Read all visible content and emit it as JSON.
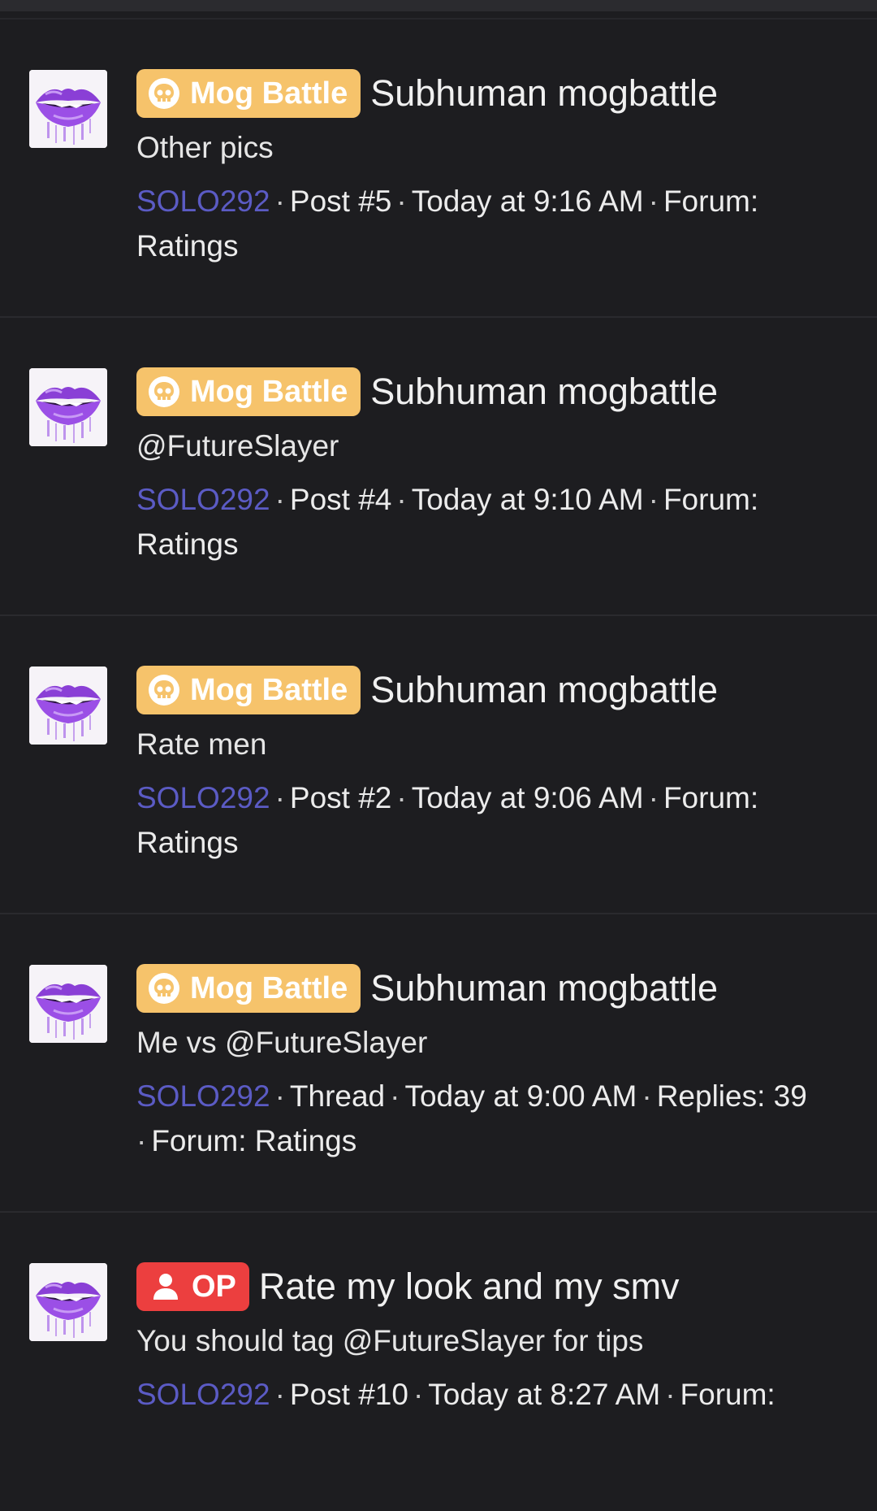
{
  "results": [
    {
      "badge": {
        "type": "mog",
        "label": "Mog Battle",
        "icon": "skull-icon"
      },
      "title": "Subhuman mogbattle",
      "snippet": "Other pics",
      "author": "SOLO292",
      "post": "Post #5",
      "time": "Today at 9:16 AM",
      "tail1": "Forum:",
      "tail2": "Ratings"
    },
    {
      "badge": {
        "type": "mog",
        "label": "Mog Battle",
        "icon": "skull-icon"
      },
      "title": "Subhuman mogbattle",
      "snippet": "@FutureSlayer",
      "author": "SOLO292",
      "post": "Post #4",
      "time": "Today at 9:10 AM",
      "tail1": "Forum:",
      "tail2": "Ratings"
    },
    {
      "badge": {
        "type": "mog",
        "label": "Mog Battle",
        "icon": "skull-icon"
      },
      "title": "Subhuman mogbattle",
      "snippet": "Rate men",
      "author": "SOLO292",
      "post": "Post #2",
      "time": "Today at 9:06 AM",
      "tail1": "Forum:",
      "tail2": "Ratings"
    },
    {
      "badge": {
        "type": "mog",
        "label": "Mog Battle",
        "icon": "skull-icon"
      },
      "title": "Subhuman mogbattle",
      "snippet": "Me vs @FutureSlayer",
      "author": "SOLO292",
      "post": "Thread",
      "time": "Today at 9:00 AM",
      "tail1": "Replies: 39",
      "tail2": "Forum: Ratings"
    },
    {
      "badge": {
        "type": "op",
        "label": "OP",
        "icon": "user-icon"
      },
      "title": "Rate my look and my smv",
      "snippet": "You should tag @FutureSlayer for tips",
      "author": "SOLO292",
      "post": "Post #10",
      "time": "Today at 8:27 AM",
      "tail1": "Forum:",
      "tail2": ""
    }
  ],
  "colors": {
    "background": "#1d1d20",
    "mog_badge": "#f6c36b",
    "op_badge": "#ec3f3f",
    "author_link": "#5b5bc4",
    "avatar_lips": "#8a3fd6"
  }
}
